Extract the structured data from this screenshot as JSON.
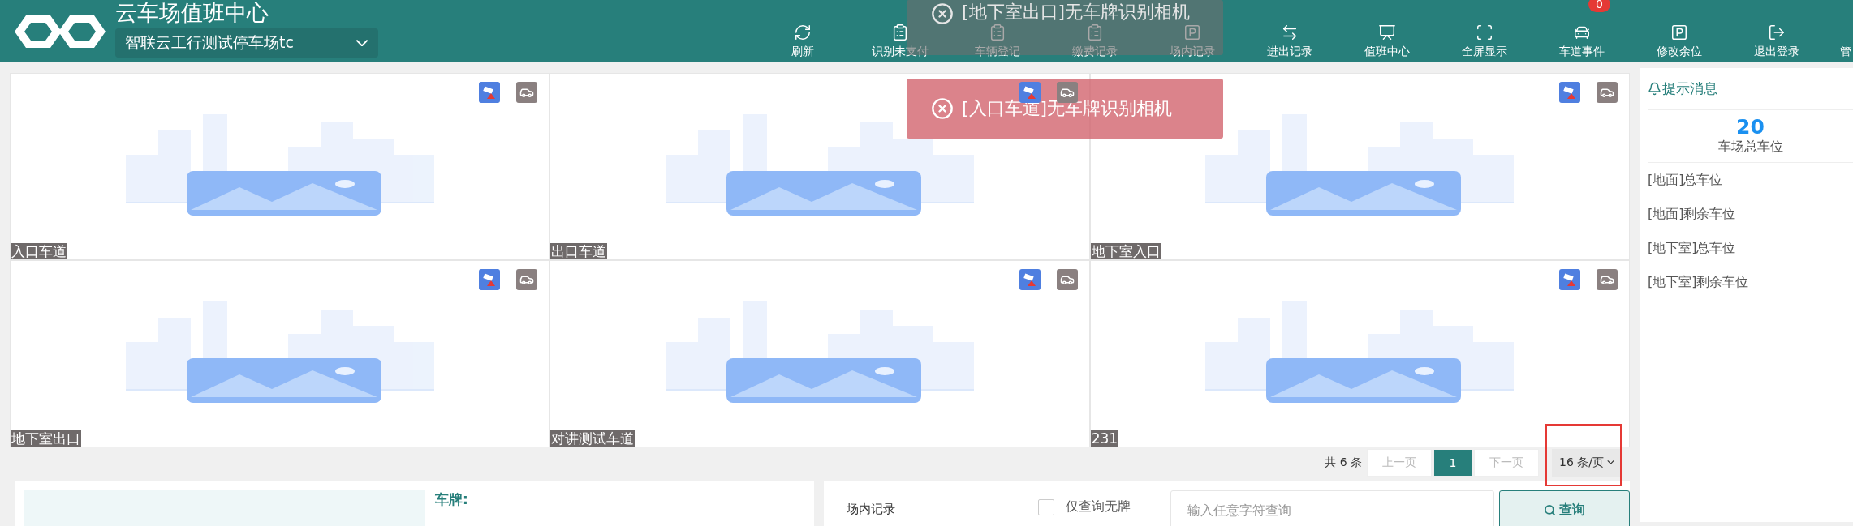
{
  "header": {
    "title": "云车场值班中心",
    "parking_lot": "智联云工行测试停车场tc",
    "nav": [
      {
        "label": "刷新",
        "kind": "refresh"
      },
      {
        "label": "识别未支付",
        "kind": "clipboard"
      },
      {
        "label": "车辆登记",
        "kind": "clipboard"
      },
      {
        "label": "缴费记录",
        "kind": "clipboard"
      },
      {
        "label": "场内记录",
        "kind": "parking"
      },
      {
        "label": "进出记录",
        "kind": "exchange"
      },
      {
        "label": "值班中心",
        "kind": "monitor"
      },
      {
        "label": "全屏显示",
        "kind": "fullscreen"
      },
      {
        "label": "车道事件",
        "kind": "car",
        "badge": "0"
      },
      {
        "label": "修改余位",
        "kind": "parking"
      },
      {
        "label": "退出登录",
        "kind": "logout"
      },
      {
        "label": "管",
        "kind": "cut"
      }
    ]
  },
  "toasts": [
    {
      "text": "[地下室出口]无车牌识别相机",
      "faded": true
    },
    {
      "text": "[入口车道]无车牌识别相机",
      "faded": false
    }
  ],
  "lanes": [
    {
      "name": "入口车道"
    },
    {
      "name": "出口车道"
    },
    {
      "name": "地下室入口"
    },
    {
      "name": "地下室出口"
    },
    {
      "name": "对讲测试车道"
    },
    {
      "name": "231"
    }
  ],
  "pagination": {
    "total": "共 6 条",
    "prev": {
      "label": "上一页",
      "disabled": true
    },
    "pages": [
      {
        "label": "1",
        "selected": true
      }
    ],
    "next": {
      "label": "下一页",
      "disabled": true
    },
    "page_size": "16 条/页"
  },
  "messages": {
    "title": "提示消息",
    "total_count": "20",
    "total_label": "车场总车位",
    "items": [
      "[地面]总车位",
      "[地面]剩余车位",
      "[地下室]总车位",
      "[地下室]剩余车位"
    ]
  },
  "plate_panel": {
    "label": "车牌:"
  },
  "records": {
    "title": "场内记录",
    "only_unlicensed": {
      "label": "仅查询无牌",
      "checked": false
    },
    "search": {
      "placeholder": "输入任意字符查询"
    },
    "button": "查询"
  }
}
